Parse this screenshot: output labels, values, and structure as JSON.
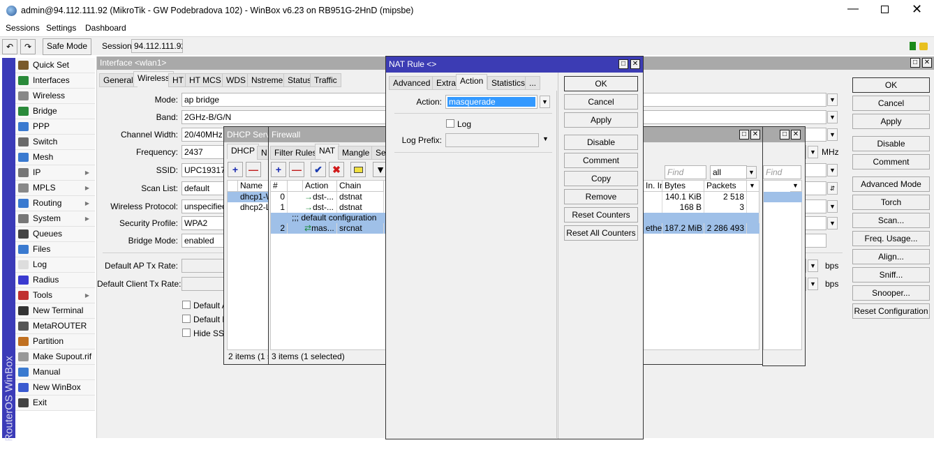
{
  "app": {
    "title": "admin@94.112.111.92 (MikroTik - GW Podebradova 102) - WinBox v6.23 on RB951G-2HnD (mipsbe)",
    "menu": [
      "Sessions",
      "Settings",
      "Dashboard"
    ],
    "safe_mode": "Safe Mode",
    "session_label": "Session:",
    "session_value": "94.112.111.92",
    "side_brand": "RouterOS WinBox"
  },
  "sidebar": [
    {
      "label": "Quick Set",
      "icon": "wand-icon",
      "color": "#7a5a2a"
    },
    {
      "label": "Interfaces",
      "icon": "interfaces-icon",
      "color": "#2a8a3a"
    },
    {
      "label": "Wireless",
      "icon": "wireless-icon",
      "color": "#888"
    },
    {
      "label": "Bridge",
      "icon": "bridge-icon",
      "color": "#2a8a3a"
    },
    {
      "label": "PPP",
      "icon": "ppp-icon",
      "color": "#3a7ad0"
    },
    {
      "label": "Switch",
      "icon": "switch-icon",
      "color": "#6a6a6a"
    },
    {
      "label": "Mesh",
      "icon": "mesh-icon",
      "color": "#3a7ad0"
    },
    {
      "label": "IP",
      "icon": "ip-icon",
      "color": "#777",
      "sub": true
    },
    {
      "label": "MPLS",
      "icon": "mpls-icon",
      "color": "#888",
      "sub": true
    },
    {
      "label": "Routing",
      "icon": "routing-icon",
      "color": "#3a7ad0",
      "sub": true
    },
    {
      "label": "System",
      "icon": "system-icon",
      "color": "#777",
      "sub": true
    },
    {
      "label": "Queues",
      "icon": "queues-icon",
      "color": "#444"
    },
    {
      "label": "Files",
      "icon": "files-icon",
      "color": "#3a7ad0"
    },
    {
      "label": "Log",
      "icon": "log-icon",
      "color": "#ddd"
    },
    {
      "label": "Radius",
      "icon": "radius-icon",
      "color": "#3a3ad0"
    },
    {
      "label": "Tools",
      "icon": "tools-icon",
      "color": "#c03030",
      "sub": true
    },
    {
      "label": "New Terminal",
      "icon": "terminal-icon",
      "color": "#333"
    },
    {
      "label": "MetaROUTER",
      "icon": "metarouter-icon",
      "color": "#555"
    },
    {
      "label": "Partition",
      "icon": "partition-icon",
      "color": "#c07020"
    },
    {
      "label": "Make Supout.rif",
      "icon": "supout-icon",
      "color": "#999"
    },
    {
      "label": "Manual",
      "icon": "manual-icon",
      "color": "#3a7ad0"
    },
    {
      "label": "New WinBox",
      "icon": "winbox-icon",
      "color": "#3a5ad0"
    },
    {
      "label": "Exit",
      "icon": "exit-icon",
      "color": "#444"
    }
  ],
  "iface": {
    "title": "Interface <wlan1>",
    "tabs": [
      "General",
      "Wireless",
      "HT",
      "HT MCS",
      "WDS",
      "Nstreme",
      "Status",
      "Traffic"
    ],
    "active_tab": "Wireless",
    "fields": [
      {
        "label": "Mode:",
        "value": "ap bridge"
      },
      {
        "label": "Band:",
        "value": "2GHz-B/G/N"
      },
      {
        "label": "Channel Width:",
        "value": "20/40MHz HT Above"
      },
      {
        "label": "Frequency:",
        "value": "2437",
        "unit": "MHz"
      },
      {
        "label": "SSID:",
        "value": "UPC1931758"
      },
      {
        "label": "Scan List:",
        "value": "default"
      },
      {
        "label": "Wireless Protocol:",
        "value": "unspecified"
      },
      {
        "label": "Security Profile:",
        "value": "WPA2"
      },
      {
        "label": "Bridge Mode:",
        "value": "enabled"
      },
      {
        "label": "Default AP Tx Rate:",
        "value": "",
        "unit": "bps"
      },
      {
        "label": "Default Client Tx Rate:",
        "value": "",
        "unit": "bps"
      }
    ],
    "checkboxes": [
      "Default Authenticate",
      "Default Forward",
      "Hide SSID"
    ],
    "buttons": [
      "OK",
      "Cancel",
      "Apply",
      "Disable",
      "Comment",
      "Advanced Mode",
      "Torch",
      "Scan...",
      "Freq. Usage...",
      "Align...",
      "Sniff...",
      "Snooper...",
      "Reset Configuration"
    ]
  },
  "dhcp": {
    "title": "DHCP Server",
    "tabs": [
      "DHCP",
      "N"
    ],
    "col": "Name",
    "rows": [
      "dhcp1-WAN",
      "dhcp2-LAN"
    ],
    "status": "2 items (1 selected)"
  },
  "firewall": {
    "title": "Firewall",
    "tabs": [
      "Filter Rules",
      "NAT",
      "Mangle",
      "Service Ports"
    ],
    "active_tab": "NAT",
    "find_placeholder": "Find",
    "filter": "all",
    "cols": [
      "#",
      "",
      "Action",
      "Chain",
      "In. Int...",
      "Bytes",
      "Packets"
    ],
    "rows": [
      {
        "num": "0",
        "action": "dst-...",
        "chain": "dstnat",
        "iface": "",
        "bytes": "140.1 KiB",
        "packets": "2 518"
      },
      {
        "num": "1",
        "action": "dst-...",
        "chain": "dstnat",
        "iface": "",
        "bytes": "168 B",
        "packets": "3"
      },
      {
        "comment": ";;; default configuration"
      },
      {
        "num": "2",
        "action": "mas...",
        "chain": "srcnat",
        "iface": "ether1-...",
        "bytes": "187.2 MiB",
        "packets": "2 286 493",
        "selected": true
      }
    ],
    "status": "3 items (1 selected)"
  },
  "third": {
    "find_placeholder": "Find"
  },
  "nat": {
    "title": "NAT Rule <>",
    "tabs": [
      "Advanced",
      "Extra",
      "Action",
      "Statistics",
      "..."
    ],
    "active_tab": "Action",
    "action_label": "Action:",
    "action_value": "masquerade",
    "log_label": "Log",
    "log_prefix_label": "Log Prefix:",
    "log_prefix_value": "",
    "buttons": [
      "OK",
      "Cancel",
      "Apply",
      "Disable",
      "Comment",
      "Copy",
      "Remove",
      "Reset Counters",
      "Reset All Counters"
    ]
  },
  "colors": {
    "brand_strip": "#3b3bb8",
    "title_active": "#3c3cb4",
    "selection": "#9fc0e8"
  }
}
